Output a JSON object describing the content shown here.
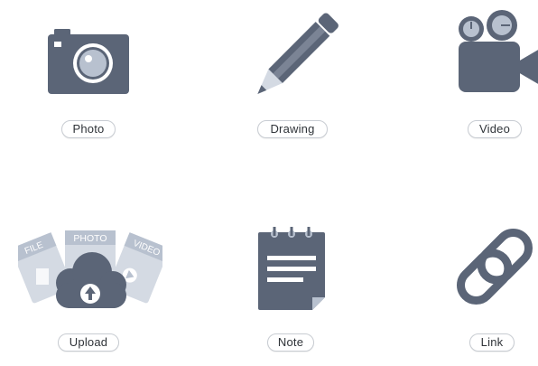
{
  "colors": {
    "icon_primary": "#5b6577",
    "icon_light": "#b8c1cf",
    "icon_lighter": "#d4dae3",
    "pill_border": "#c8ccd2",
    "pill_text": "#2f3338"
  },
  "tiles": [
    {
      "label": "Photo",
      "icon": "camera-icon"
    },
    {
      "label": "Drawing",
      "icon": "pencil-icon"
    },
    {
      "label": "Video",
      "icon": "video-camera-icon"
    },
    {
      "label": "Upload",
      "icon": "upload-cloud-icon",
      "file_badges": [
        "FILE",
        "PHOTO",
        "VIDEO"
      ]
    },
    {
      "label": "Note",
      "icon": "notepad-icon"
    },
    {
      "label": "Link",
      "icon": "chain-link-icon"
    }
  ]
}
